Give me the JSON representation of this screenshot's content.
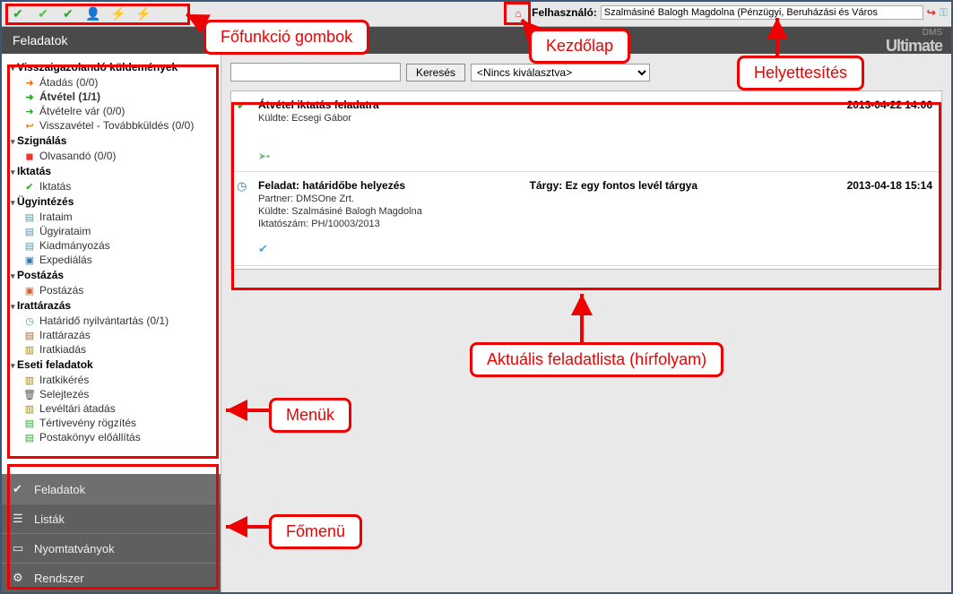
{
  "header": {
    "title": "Feladatok",
    "user_label": "Felhasználó:",
    "user_value": "Szalmásiné Balogh Magdolna (Pénzügyi, Beruházási és Város",
    "brand_small": "DMS",
    "brand_big": "Ultimate"
  },
  "search": {
    "button": "Keresés",
    "select": "<Nincs kiválasztva>"
  },
  "tree": {
    "sec1": "Visszaigazolandó küldemények",
    "s1i1": "Átadás (0/0)",
    "s1i2": "Átvétel (1/1)",
    "s1i3": "Átvételre vár (0/0)",
    "s1i4": "Visszavétel - Továbbküldés (0/0)",
    "sec2": "Szignálás",
    "s2i1": "Olvasandó (0/0)",
    "sec3": "Iktatás",
    "s3i1": "Iktatás",
    "sec4": "Ügyintézés",
    "s4i1": "Irataim",
    "s4i2": "Ügyirataim",
    "s4i3": "Kiadmányozás",
    "s4i4": "Expediálás",
    "sec5": "Postázás",
    "s5i1": "Postázás",
    "sec6": "Irattárazás",
    "s6i1": "Határidő nyilvántartás (0/1)",
    "s6i2": "Irattárazás",
    "s6i3": "Iratkiadás",
    "sec7": "Eseti feladatok",
    "s7i1": "Iratkikérés",
    "s7i2": "Selejtezés",
    "s7i3": "Levéltári átadás",
    "s7i4": "Tértivevény rögzítés",
    "s7i5": "Postakönyv előállítás"
  },
  "mainmenu": {
    "m1": "Feladatok",
    "m2": "Listák",
    "m3": "Nyomtatványok",
    "m4": "Rendszer"
  },
  "feed": {
    "item1": {
      "title": "Átvétel iktatás feladatra",
      "sender": "Küldte: Ecsegi Gábor",
      "timestamp": "2013-04-22 14:06"
    },
    "item2": {
      "title": "Feladat: határidőbe helyezés",
      "subject": "Tárgy: Ez egy fontos levél tárgya",
      "partner": "Partner: DMSOne Zrt.",
      "sender": "Küldte: Szalmásiné Balogh Magdolna",
      "iktsz": "Iktatószám: PH/10003/2013",
      "timestamp": "2013-04-18 15:14"
    }
  },
  "callouts": {
    "c_toolbar": "Főfunkció gombok",
    "c_home": "Kezdőlap",
    "c_user": "Helyettesítés",
    "c_menus": "Menük",
    "c_mainmenu": "Főmenü",
    "c_feed": "Aktuális feladatlista (hírfolyam)"
  }
}
